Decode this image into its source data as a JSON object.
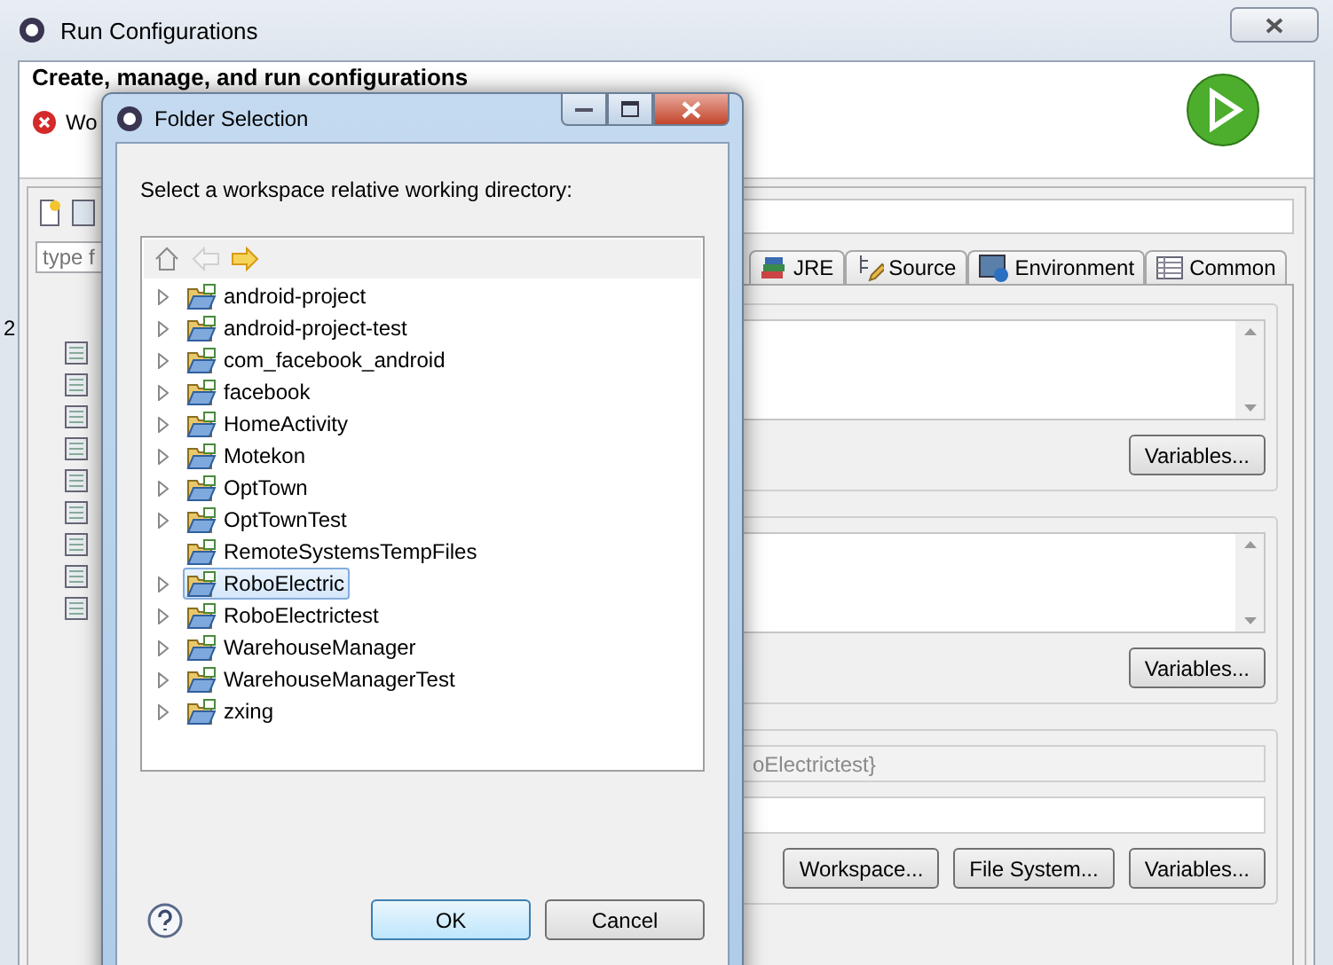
{
  "window": {
    "title": "Run Configurations"
  },
  "header": {
    "title": "Create, manage, and run configurations",
    "error": "Wo"
  },
  "left_pane": {
    "filter_placeholder": "type f",
    "edge_text": "2"
  },
  "tabs": [
    {
      "label": "JRE",
      "kind": "jre"
    },
    {
      "label": "Source",
      "kind": "source"
    },
    {
      "label": "Environment",
      "kind": "environment"
    },
    {
      "label": "Common",
      "kind": "common"
    }
  ],
  "groups": [
    {
      "kind": "text",
      "button": "Variables..."
    },
    {
      "kind": "text",
      "button": "Variables..."
    },
    {
      "kind": "dir",
      "value": "oElectrictest}",
      "buttons": [
        "Workspace...",
        "File System...",
        "Variables..."
      ]
    }
  ],
  "dialog": {
    "title": "Folder Selection",
    "prompt": "Select a workspace relative working directory:",
    "nav": [
      {
        "kind": "home",
        "disabled": false
      },
      {
        "kind": "back",
        "disabled": true
      },
      {
        "kind": "forward",
        "disabled": false
      }
    ],
    "folders": [
      {
        "name": "android-project",
        "expandable": true,
        "selected": false
      },
      {
        "name": "android-project-test",
        "expandable": true,
        "selected": false
      },
      {
        "name": "com_facebook_android",
        "expandable": true,
        "selected": false
      },
      {
        "name": "facebook",
        "expandable": true,
        "selected": false
      },
      {
        "name": "HomeActivity",
        "expandable": true,
        "selected": false
      },
      {
        "name": "Motekon",
        "expandable": true,
        "selected": false
      },
      {
        "name": "OptTown",
        "expandable": true,
        "selected": false
      },
      {
        "name": "OptTownTest",
        "expandable": true,
        "selected": false
      },
      {
        "name": "RemoteSystemsTempFiles",
        "expandable": false,
        "selected": false
      },
      {
        "name": "RoboElectric",
        "expandable": true,
        "selected": true
      },
      {
        "name": "RoboElectrictest",
        "expandable": true,
        "selected": false
      },
      {
        "name": "WarehouseManager",
        "expandable": true,
        "selected": false
      },
      {
        "name": "WarehouseManagerTest",
        "expandable": true,
        "selected": false
      },
      {
        "name": "zxing",
        "expandable": true,
        "selected": false
      }
    ],
    "buttons": [
      {
        "label": "OK",
        "primary": true
      },
      {
        "label": "Cancel",
        "primary": false
      }
    ]
  }
}
